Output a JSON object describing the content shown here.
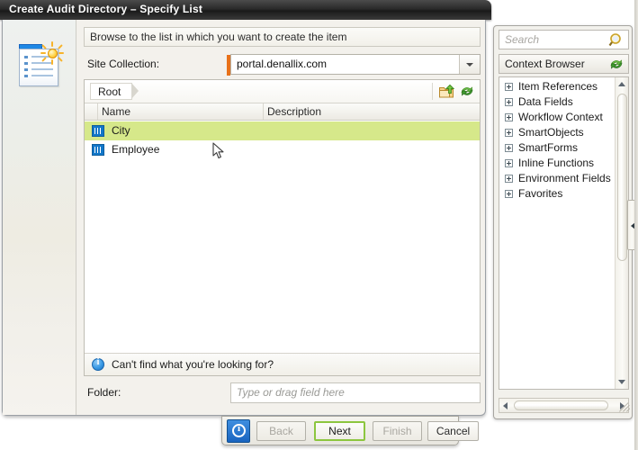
{
  "window": {
    "title": "Create Audit Directory – Specify List"
  },
  "wizard": {
    "icon": "new-list-item-icon",
    "banner": "Browse to the list in which you want to create the item",
    "site_collection": {
      "label": "Site Collection:",
      "value": "portal.denallix.com",
      "dropdown_icon": "chevron-down-icon",
      "required_marker_color": "#e8711a"
    },
    "browser": {
      "breadcrumb": "Root",
      "toolbar": [
        {
          "name": "navigate-up-icon",
          "title": "Up"
        },
        {
          "name": "refresh-icon",
          "title": "Refresh"
        }
      ],
      "columns": [
        "Name",
        "Description"
      ],
      "rows": [
        {
          "name": "City",
          "description": "",
          "selected": true,
          "icon": "list-icon"
        },
        {
          "name": "Employee",
          "description": "",
          "selected": false,
          "icon": "list-icon"
        }
      ],
      "footer_note": "Can't find what you're looking for?",
      "footer_icon": "info-icon"
    },
    "folder": {
      "label": "Folder:",
      "value": "",
      "placeholder": "Type or drag field here"
    }
  },
  "footer": {
    "help_icon": "help-info-icon",
    "buttons": [
      {
        "id": "back",
        "label": "Back",
        "state": "disabled"
      },
      {
        "id": "next",
        "label": "Next",
        "state": "default"
      },
      {
        "id": "finish",
        "label": "Finish",
        "state": "disabled"
      },
      {
        "id": "cancel",
        "label": "Cancel",
        "state": "normal"
      }
    ],
    "default_button_border_color": "#8cc63f"
  },
  "context_panel": {
    "search": {
      "placeholder": "Search",
      "value": "",
      "icon": "search-icon"
    },
    "header": {
      "title": "Context Browser",
      "refresh_icon": "refresh-icon"
    },
    "tree": [
      {
        "label": "Item References",
        "expander": "plus"
      },
      {
        "label": "Data Fields",
        "expander": "plus"
      },
      {
        "label": "Workflow Context",
        "expander": "plus"
      },
      {
        "label": "SmartObjects",
        "expander": "plus"
      },
      {
        "label": "SmartForms",
        "expander": "plus"
      },
      {
        "label": "Inline Functions",
        "expander": "plus"
      },
      {
        "label": "Environment Fields",
        "expander": "plus"
      },
      {
        "label": "Favorites",
        "expander": "plus"
      }
    ],
    "scrollbars": {
      "vertical": true,
      "horizontal": true
    },
    "collapse_handle_icon": "chevron-left-icon"
  },
  "colors": {
    "selection": "#d6e88a",
    "accent": "#1277c9",
    "titlebar": "#2a2a2a"
  }
}
